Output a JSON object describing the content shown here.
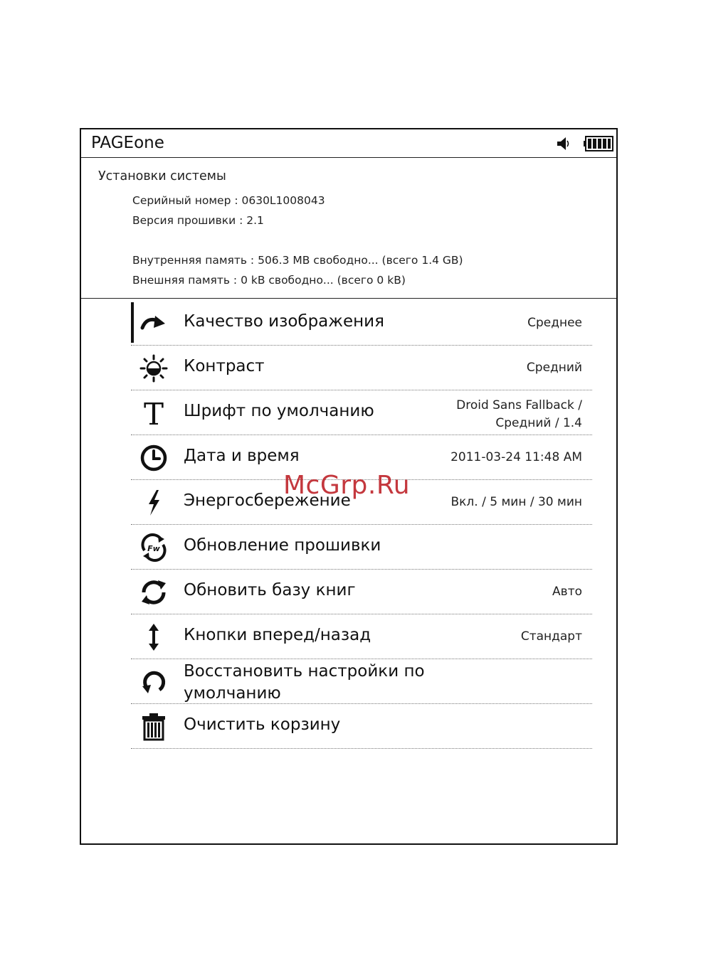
{
  "header": {
    "title": "PAGEone",
    "speaker_icon": "speaker-icon",
    "battery_icon": "battery-full-icon"
  },
  "system": {
    "heading": "Установки системы",
    "serial": "Серийный номер : 0630L1008043",
    "firmware": "Версия прошивки : 2.1",
    "internal_memory": "Внутренняя память : 506.3 MB свободно... (всего 1.4 GB)",
    "external_memory": "Внешняя память : 0 kB свободно... (всего 0 kB)"
  },
  "menu": {
    "items": [
      {
        "label": "Качество изображения",
        "value": "Среднее",
        "icon": "refresh-arrow-icon"
      },
      {
        "label": "Контраст",
        "value": "Средний",
        "icon": "contrast-sun-icon"
      },
      {
        "label": "Шрифт по умолчанию",
        "value_line1": "Droid Sans Fallback /",
        "value_line2": "Средний / 1.4",
        "icon": "font-icon"
      },
      {
        "label": "Дата и время",
        "value": "2011-03-24  11:48 AM",
        "icon": "clock-icon"
      },
      {
        "label": "Энергосбережение",
        "value": "Вкл. / 5 мин / 30 мин",
        "icon": "lightning-icon"
      },
      {
        "label": "Обновление прошивки",
        "value": "",
        "icon": "firmware-update-icon"
      },
      {
        "label": "Обновить базу книг",
        "value": "Авто",
        "icon": "sync-icon"
      },
      {
        "label": "Кнопки вперед/назад",
        "value": "Стандарт",
        "icon": "up-down-arrow-icon"
      },
      {
        "label": "Восстановить настройки по умолчанию",
        "value": "",
        "icon": "restore-icon"
      },
      {
        "label": "Очистить корзину",
        "value": "",
        "icon": "trash-icon"
      }
    ]
  },
  "watermark": "McGrp.Ru"
}
